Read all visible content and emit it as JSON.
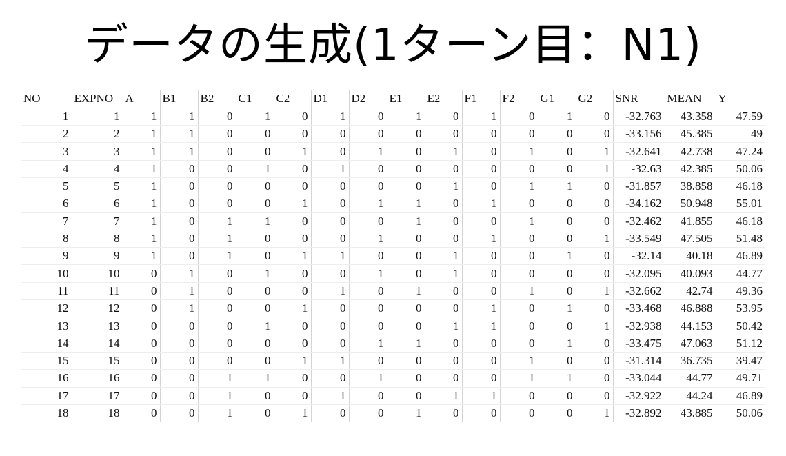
{
  "title": "データの生成(1ターン目：N1)",
  "table": {
    "headers": [
      "NO",
      "EXPNO",
      "A",
      "B1",
      "B2",
      "C1",
      "C2",
      "D1",
      "D2",
      "E1",
      "E2",
      "F1",
      "F2",
      "G1",
      "G2",
      "SNR",
      "MEAN",
      "Y"
    ],
    "rows": [
      [
        "1",
        "1",
        "1",
        "1",
        "0",
        "1",
        "0",
        "1",
        "0",
        "1",
        "0",
        "1",
        "0",
        "1",
        "0",
        "-32.763",
        "43.358",
        "47.59"
      ],
      [
        "2",
        "2",
        "1",
        "1",
        "0",
        "0",
        "0",
        "0",
        "0",
        "0",
        "0",
        "0",
        "0",
        "0",
        "0",
        "-33.156",
        "45.385",
        "49"
      ],
      [
        "3",
        "3",
        "1",
        "1",
        "0",
        "0",
        "1",
        "0",
        "1",
        "0",
        "1",
        "0",
        "1",
        "0",
        "1",
        "-32.641",
        "42.738",
        "47.24"
      ],
      [
        "4",
        "4",
        "1",
        "0",
        "0",
        "1",
        "0",
        "1",
        "0",
        "0",
        "0",
        "0",
        "0",
        "0",
        "1",
        "-32.63",
        "42.385",
        "50.06"
      ],
      [
        "5",
        "5",
        "1",
        "0",
        "0",
        "0",
        "0",
        "0",
        "0",
        "0",
        "1",
        "0",
        "1",
        "1",
        "0",
        "-31.857",
        "38.858",
        "46.18"
      ],
      [
        "6",
        "6",
        "1",
        "0",
        "0",
        "0",
        "1",
        "0",
        "1",
        "1",
        "0",
        "1",
        "0",
        "0",
        "0",
        "-34.162",
        "50.948",
        "55.01"
      ],
      [
        "7",
        "7",
        "1",
        "0",
        "1",
        "1",
        "0",
        "0",
        "0",
        "1",
        "0",
        "0",
        "1",
        "0",
        "0",
        "-32.462",
        "41.855",
        "46.18"
      ],
      [
        "8",
        "8",
        "1",
        "0",
        "1",
        "0",
        "0",
        "0",
        "1",
        "0",
        "0",
        "1",
        "0",
        "0",
        "1",
        "-33.549",
        "47.505",
        "51.48"
      ],
      [
        "9",
        "9",
        "1",
        "0",
        "1",
        "0",
        "1",
        "1",
        "0",
        "0",
        "1",
        "0",
        "0",
        "1",
        "0",
        "-32.14",
        "40.18",
        "46.89"
      ],
      [
        "10",
        "10",
        "0",
        "1",
        "0",
        "1",
        "0",
        "0",
        "1",
        "0",
        "1",
        "0",
        "0",
        "0",
        "0",
        "-32.095",
        "40.093",
        "44.77"
      ],
      [
        "11",
        "11",
        "0",
        "1",
        "0",
        "0",
        "0",
        "1",
        "0",
        "1",
        "0",
        "0",
        "1",
        "0",
        "1",
        "-32.662",
        "42.74",
        "49.36"
      ],
      [
        "12",
        "12",
        "0",
        "1",
        "0",
        "0",
        "1",
        "0",
        "0",
        "0",
        "0",
        "1",
        "0",
        "1",
        "0",
        "-33.468",
        "46.888",
        "53.95"
      ],
      [
        "13",
        "13",
        "0",
        "0",
        "0",
        "1",
        "0",
        "0",
        "0",
        "0",
        "1",
        "1",
        "0",
        "0",
        "1",
        "-32.938",
        "44.153",
        "50.42"
      ],
      [
        "14",
        "14",
        "0",
        "0",
        "0",
        "0",
        "0",
        "0",
        "1",
        "1",
        "0",
        "0",
        "0",
        "1",
        "0",
        "-33.475",
        "47.063",
        "51.12"
      ],
      [
        "15",
        "15",
        "0",
        "0",
        "0",
        "0",
        "1",
        "1",
        "0",
        "0",
        "0",
        "0",
        "1",
        "0",
        "0",
        "-31.314",
        "36.735",
        "39.47"
      ],
      [
        "16",
        "16",
        "0",
        "0",
        "1",
        "1",
        "0",
        "0",
        "1",
        "0",
        "0",
        "0",
        "1",
        "1",
        "0",
        "-33.044",
        "44.77",
        "49.71"
      ],
      [
        "17",
        "17",
        "0",
        "0",
        "1",
        "0",
        "0",
        "1",
        "0",
        "0",
        "1",
        "1",
        "0",
        "0",
        "0",
        "-32.922",
        "44.24",
        "46.89"
      ],
      [
        "18",
        "18",
        "0",
        "0",
        "1",
        "0",
        "1",
        "0",
        "0",
        "1",
        "0",
        "0",
        "0",
        "0",
        "1",
        "-32.892",
        "43.885",
        "50.06"
      ]
    ]
  }
}
